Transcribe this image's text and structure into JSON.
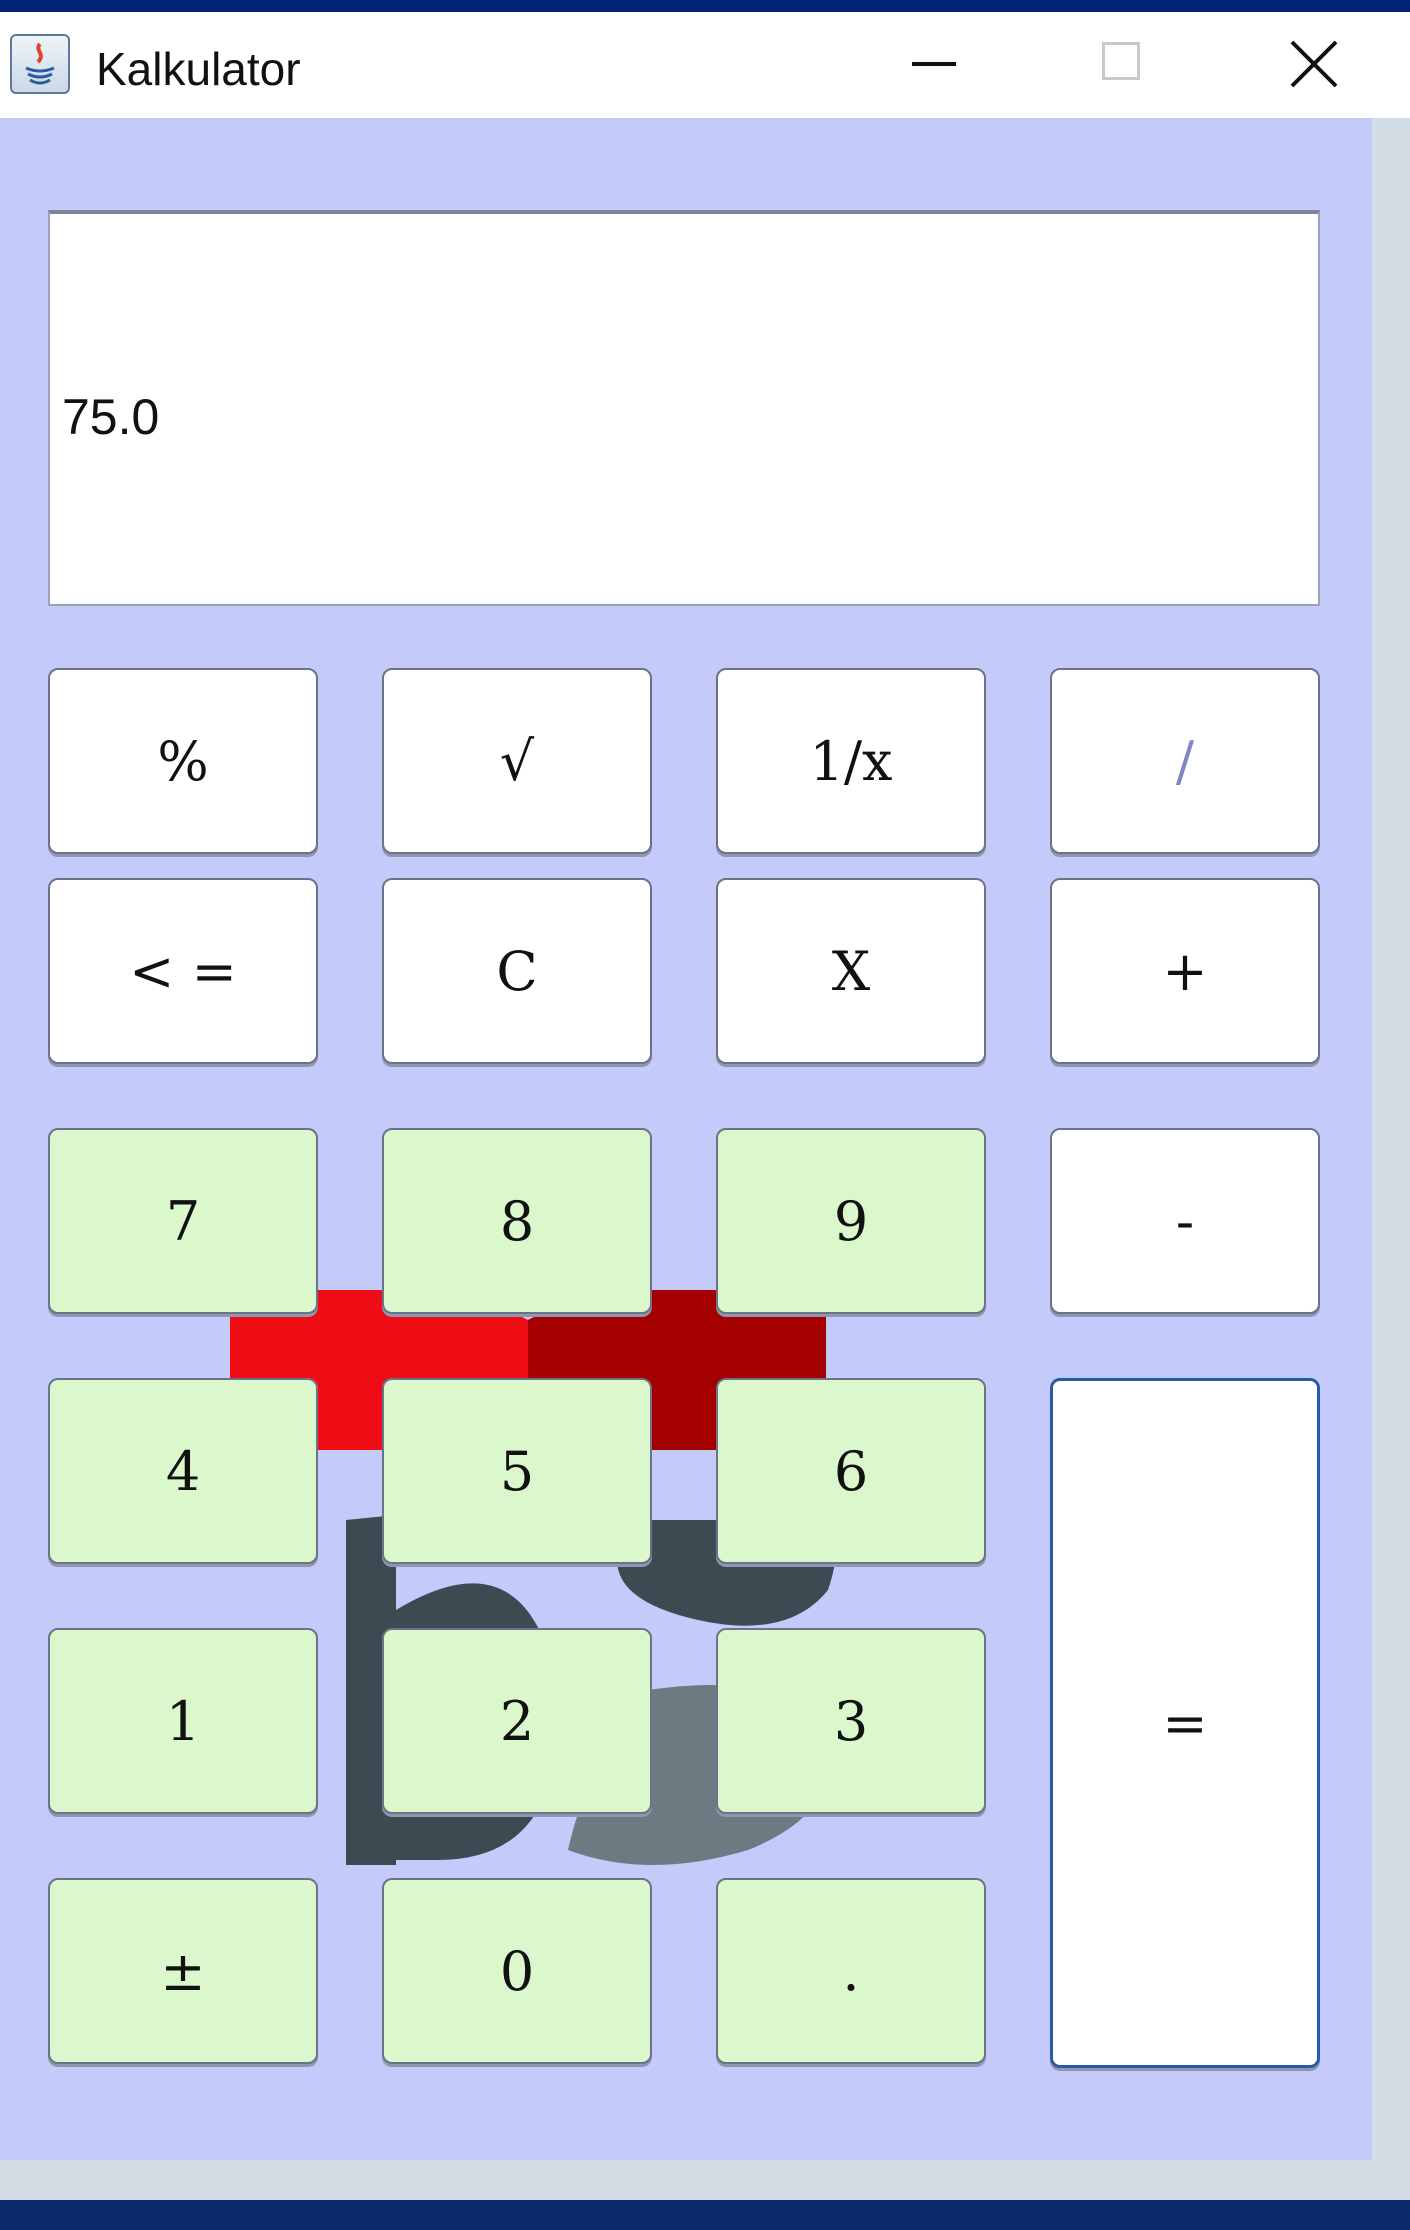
{
  "window": {
    "title": "Kalkulator",
    "controls": {
      "minimize_icon": "minimize-icon",
      "maximize_icon": "maximize-icon",
      "close_icon": "close-icon"
    }
  },
  "display": {
    "value": "75.0"
  },
  "keys": {
    "percent": "%",
    "sqrt": "√",
    "reciprocal": "1/x",
    "divide": "/",
    "backspace": "< =",
    "clear": "C",
    "multiply": "X",
    "add": "+",
    "seven": "7",
    "eight": "8",
    "nine": "9",
    "subtract": "-",
    "four": "4",
    "five": "5",
    "six": "6",
    "equals": "=",
    "one": "1",
    "two": "2",
    "three": "3",
    "negate": "±",
    "zero": "0",
    "decimal": "."
  },
  "colors": {
    "background": "#c4caf9",
    "digit_key": "#daf8cb",
    "operator_key": "#ffffff",
    "equals_border": "#2b59a8"
  }
}
